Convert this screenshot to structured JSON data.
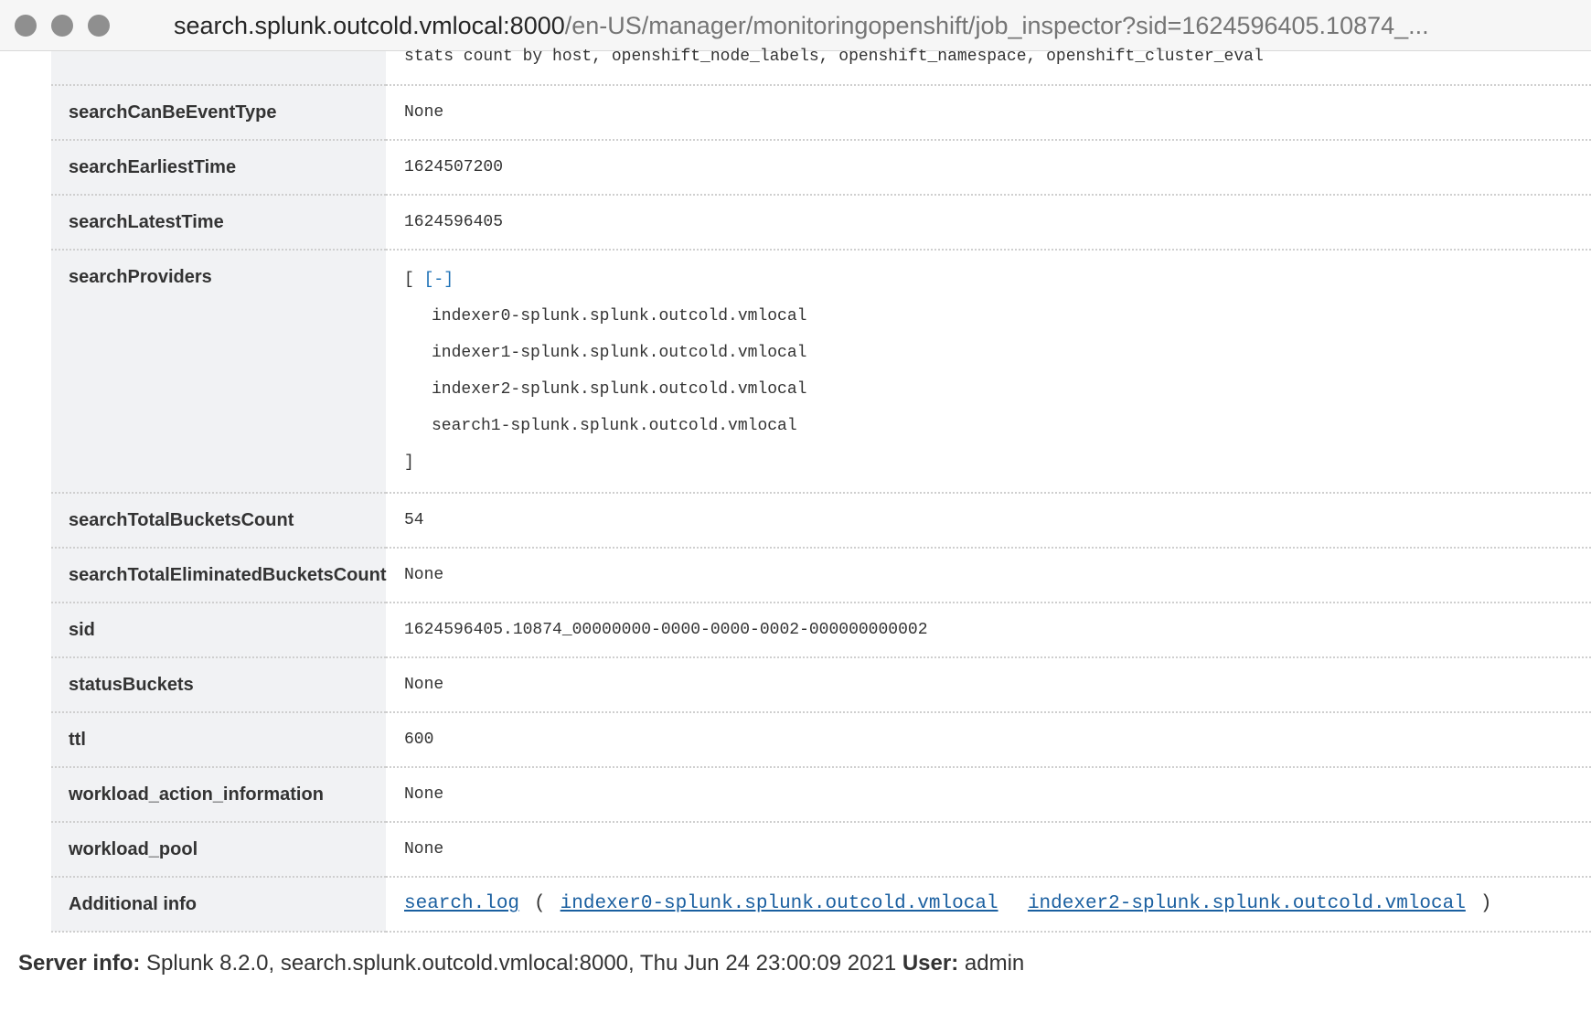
{
  "window": {
    "url_host": "search.splunk.outcold.vmlocal:8000",
    "url_path": "/en-US/manager/monitoringopenshift/job_inspector?sid=1624596405.10874_..."
  },
  "properties": {
    "search_tail": "stats count by host, openshift_node_labels, openshift_namespace, openshift_cluster_eval",
    "rows": [
      {
        "key": "searchCanBeEventType",
        "value": "None"
      },
      {
        "key": "searchEarliestTime",
        "value": "1624507200"
      },
      {
        "key": "searchLatestTime",
        "value": "1624596405"
      }
    ],
    "search_providers": {
      "key": "searchProviders",
      "open_bracket": "[",
      "toggle": "[-]",
      "items": [
        "indexer0-splunk.splunk.outcold.vmlocal",
        "indexer1-splunk.splunk.outcold.vmlocal",
        "indexer2-splunk.splunk.outcold.vmlocal",
        "search1-splunk.splunk.outcold.vmlocal"
      ],
      "close_bracket": "]"
    },
    "rows_after": [
      {
        "key": "searchTotalBucketsCount",
        "value": "54"
      },
      {
        "key": "searchTotalEliminatedBucketsCount",
        "value": "None"
      },
      {
        "key": "sid",
        "value": "1624596405.10874_00000000-0000-0000-0002-000000000002"
      },
      {
        "key": "statusBuckets",
        "value": "None"
      },
      {
        "key": "ttl",
        "value": "600"
      },
      {
        "key": "workload_action_information",
        "value": "None"
      },
      {
        "key": "workload_pool",
        "value": "None"
      }
    ],
    "additional_info": {
      "key": "Additional info",
      "search_log": "search.log",
      "open_paren": "(",
      "peer_links": [
        "indexer0-splunk.splunk.outcold.vmlocal",
        "indexer2-splunk.splunk.outcold.vmlocal"
      ],
      "close_paren": ")"
    }
  },
  "footer": {
    "server_label": "Server info:",
    "server_value": "Splunk 8.2.0, search.splunk.outcold.vmlocal:8000, Thu Jun 24 23:00:09 2021",
    "user_label": "User:",
    "user_value": "admin"
  }
}
